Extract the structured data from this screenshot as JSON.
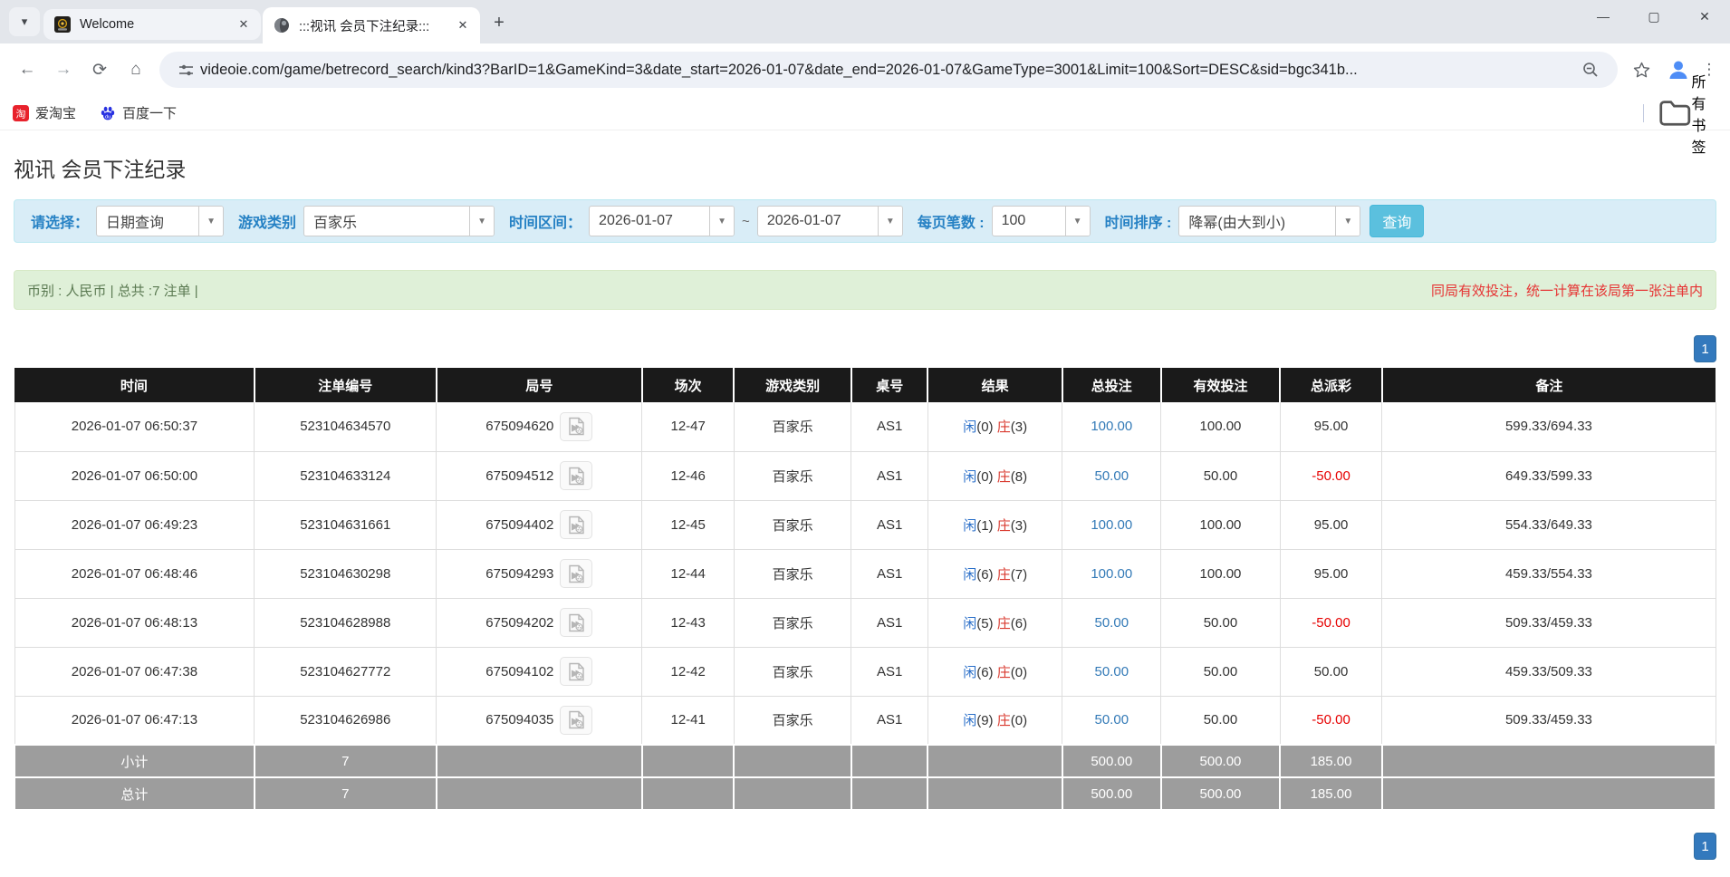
{
  "browser": {
    "tabs": [
      {
        "title": "Welcome"
      },
      {
        "title": ":::视讯 会员下注纪录:::"
      }
    ],
    "url": "videoie.com/game/betrecord_search/kind3?BarID=1&GameKind=3&date_start=2026-01-07&date_end=2026-01-07&GameType=3001&Limit=100&Sort=DESC&sid=bgc341b...",
    "bookmarks": [
      {
        "label": "爱淘宝"
      },
      {
        "label": "百度一下"
      }
    ],
    "all_bookmarks_label": "所有书签"
  },
  "page": {
    "title": "视讯 会员下注纪录",
    "filters": {
      "select_label": "请选择：",
      "select_value": "日期查询",
      "game_kind_label": "游戏类别",
      "game_kind_value": "百家乐",
      "date_range_label": "时间区间：",
      "date_start": "2026-01-07",
      "tilde": "~",
      "date_end": "2026-01-07",
      "per_page_label": "每页笔数 :",
      "per_page_value": "100",
      "sort_label": "时间排序 :",
      "sort_value": "降幂(由大到小)",
      "search_button": "查询"
    },
    "summary": {
      "left": "币别 : 人民币 | 总共 :7 注单 |",
      "right": "同局有效投注，统一计算在该局第一张注单内"
    },
    "pagination": {
      "page": "1"
    },
    "table": {
      "headers": [
        "时间",
        "注单编号",
        "局号",
        "场次",
        "游戏类别",
        "桌号",
        "结果",
        "总投注",
        "有效投注",
        "总派彩",
        "备注"
      ],
      "rows": [
        {
          "time": "2026-01-07 06:50:37",
          "bet_no": "523104634570",
          "round_no": "675094620",
          "session": "12-47",
          "game": "百家乐",
          "table_no": "AS1",
          "rp": "闲",
          "rpn": "(0)",
          "rb": "庄",
          "rbn": "(3)",
          "total_bet": "100.00",
          "valid_bet": "100.00",
          "payout": "95.00",
          "remark": "599.33/694.33"
        },
        {
          "time": "2026-01-07 06:50:00",
          "bet_no": "523104633124",
          "round_no": "675094512",
          "session": "12-46",
          "game": "百家乐",
          "table_no": "AS1",
          "rp": "闲",
          "rpn": "(0)",
          "rb": "庄",
          "rbn": "(8)",
          "total_bet": "50.00",
          "valid_bet": "50.00",
          "payout": "-50.00",
          "remark": "649.33/599.33"
        },
        {
          "time": "2026-01-07 06:49:23",
          "bet_no": "523104631661",
          "round_no": "675094402",
          "session": "12-45",
          "game": "百家乐",
          "table_no": "AS1",
          "rp": "闲",
          "rpn": "(1)",
          "rb": "庄",
          "rbn": "(3)",
          "total_bet": "100.00",
          "valid_bet": "100.00",
          "payout": "95.00",
          "remark": "554.33/649.33"
        },
        {
          "time": "2026-01-07 06:48:46",
          "bet_no": "523104630298",
          "round_no": "675094293",
          "session": "12-44",
          "game": "百家乐",
          "table_no": "AS1",
          "rp": "闲",
          "rpn": "(6)",
          "rb": "庄",
          "rbn": "(7)",
          "total_bet": "100.00",
          "valid_bet": "100.00",
          "payout": "95.00",
          "remark": "459.33/554.33"
        },
        {
          "time": "2026-01-07 06:48:13",
          "bet_no": "523104628988",
          "round_no": "675094202",
          "session": "12-43",
          "game": "百家乐",
          "table_no": "AS1",
          "rp": "闲",
          "rpn": "(5)",
          "rb": "庄",
          "rbn": "(6)",
          "total_bet": "50.00",
          "valid_bet": "50.00",
          "payout": "-50.00",
          "remark": "509.33/459.33"
        },
        {
          "time": "2026-01-07 06:47:38",
          "bet_no": "523104627772",
          "round_no": "675094102",
          "session": "12-42",
          "game": "百家乐",
          "table_no": "AS1",
          "rp": "闲",
          "rpn": "(6)",
          "rb": "庄",
          "rbn": "(0)",
          "total_bet": "50.00",
          "valid_bet": "50.00",
          "payout": "50.00",
          "remark": "459.33/509.33"
        },
        {
          "time": "2026-01-07 06:47:13",
          "bet_no": "523104626986",
          "round_no": "675094035",
          "session": "12-41",
          "game": "百家乐",
          "table_no": "AS1",
          "rp": "闲",
          "rpn": "(9)",
          "rb": "庄",
          "rbn": "(0)",
          "total_bet": "50.00",
          "valid_bet": "50.00",
          "payout": "-50.00",
          "remark": "509.33/459.33"
        }
      ],
      "subtotal": {
        "label": "小计",
        "count": "7",
        "total_bet": "500.00",
        "valid_bet": "500.00",
        "payout": "185.00"
      },
      "total": {
        "label": "总计",
        "count": "7",
        "total_bet": "500.00",
        "valid_bet": "500.00",
        "payout": "185.00"
      }
    }
  },
  "colors": {
    "accent_blue": "#337ab7",
    "result_player_blue": "#2a6fc9",
    "result_banker_red": "#d93a2f",
    "negative_red": "#e60000",
    "search_button_cyan": "#5bc0de",
    "header_black": "#1a1a1a",
    "footer_gray": "#9d9d9d",
    "filter_bg": "#d9edf7",
    "summary_bg": "#dff0d8"
  }
}
